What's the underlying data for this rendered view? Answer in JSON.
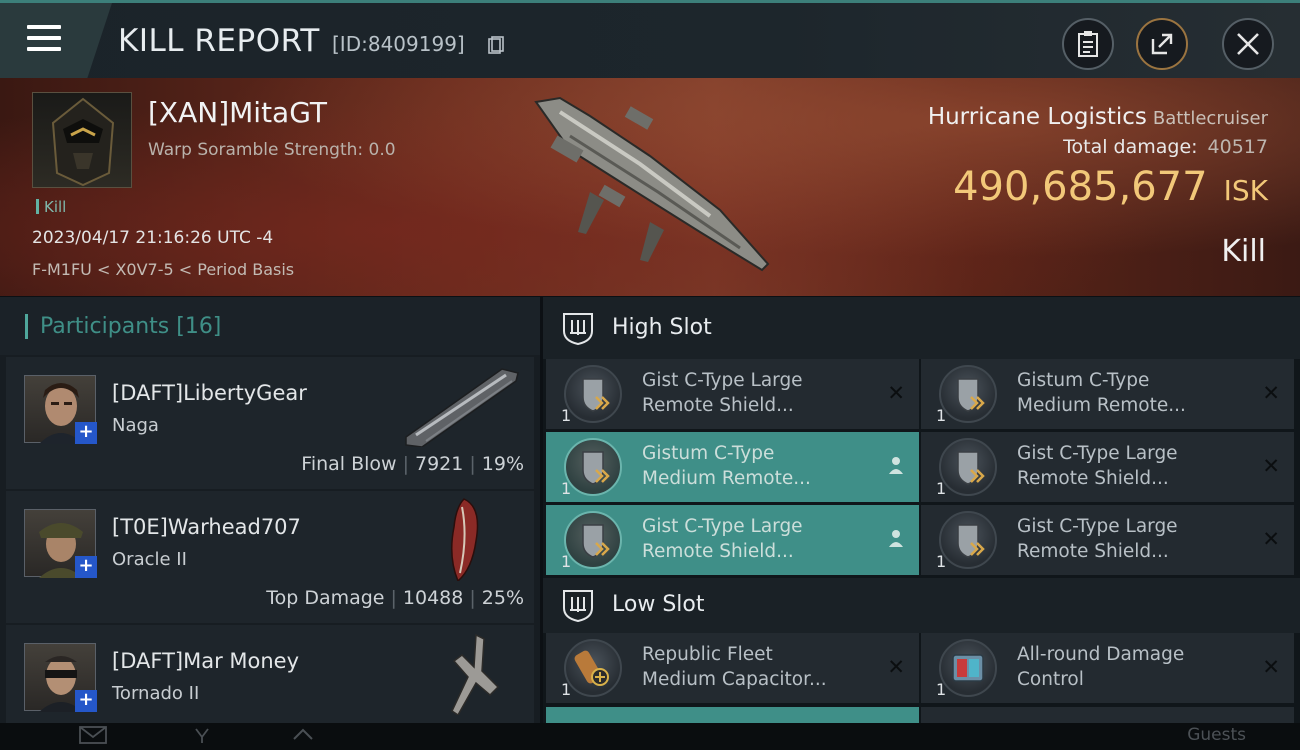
{
  "header": {
    "title": "KILL REPORT",
    "report_id": "[ID:8409199]",
    "buttons": [
      "clipboard-icon",
      "share-icon",
      "close-icon"
    ]
  },
  "victim": {
    "name": "[XAN]MitaGT",
    "warp_scramble": "Warp Soramble Strength: 0.0",
    "tag": "Kill",
    "datetime": "2023/04/17 21:16:26 UTC -4",
    "location": "F-M1FU < X0V7-5 < Period Basis"
  },
  "ship": {
    "name": "Hurricane Logistics",
    "class": "Battlecruiser",
    "damage_label": "Total damage:",
    "damage_value": "40517",
    "isk_value": "490,685,677",
    "isk_unit": "ISK",
    "result": "Kill"
  },
  "participants": {
    "label": "Participants",
    "count": "[16]",
    "items": [
      {
        "name": "[DAFT]LibertyGear",
        "ship": "Naga",
        "role": "Final Blow",
        "damage": "7921",
        "percent": "19%"
      },
      {
        "name": "[T0E]Warhead707",
        "ship": "Oracle II",
        "role": "Top Damage",
        "damage": "10488",
        "percent": "25%"
      },
      {
        "name": "[DAFT]Mar Money",
        "ship": "Tornado II",
        "role": "",
        "damage": "",
        "percent": ""
      }
    ]
  },
  "slots": {
    "high": {
      "label": "High Slot",
      "modules": [
        {
          "line1": "Gist C-Type Large",
          "line2": "Remote Shield...",
          "qty": "1",
          "highlighted": false
        },
        {
          "line1": "Gistum C-Type",
          "line2": "Medium Remote...",
          "qty": "1",
          "highlighted": false
        },
        {
          "line1": "Gistum C-Type",
          "line2": "Medium Remote...",
          "qty": "1",
          "highlighted": true
        },
        {
          "line1": "Gist C-Type Large",
          "line2": "Remote Shield...",
          "qty": "1",
          "highlighted": false
        },
        {
          "line1": "Gist C-Type Large",
          "line2": "Remote Shield...",
          "qty": "1",
          "highlighted": true
        },
        {
          "line1": "Gist C-Type Large",
          "line2": "Remote Shield...",
          "qty": "1",
          "highlighted": false
        }
      ]
    },
    "low": {
      "label": "Low Slot",
      "modules": [
        {
          "line1": "Republic Fleet",
          "line2": "Medium Capacitor...",
          "qty": "1",
          "highlighted": false
        },
        {
          "line1": "All-round Damage",
          "line2": "Control",
          "qty": "1",
          "highlighted": false
        }
      ]
    }
  },
  "dock": {
    "guests": "Guests"
  },
  "colors": {
    "accent": "#3f8f88",
    "isk": "#f2c879",
    "hero_bg": "#6a2c1e"
  }
}
